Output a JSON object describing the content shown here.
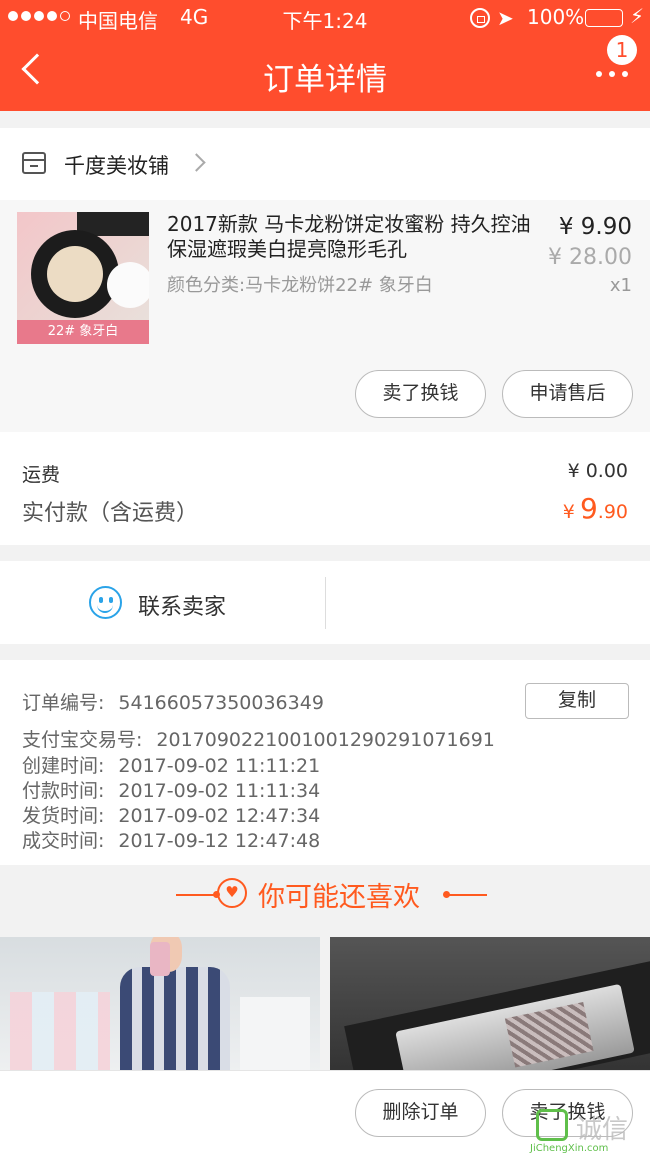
{
  "status_bar": {
    "carrier": "中国电信",
    "network": "4G",
    "time": "下午1:24",
    "battery": "100%"
  },
  "nav": {
    "title": "订单详情",
    "badge_count": "1"
  },
  "shop": {
    "name": "千度美妆铺"
  },
  "product": {
    "title": "2017新款 马卡龙粉饼定妆蜜粉 持久控油保湿遮瑕美白提亮隐形毛孔",
    "image_label": "22# 象牙白",
    "sku": "颜色分类:马卡龙粉饼22# 象牙白",
    "price": "¥ 9.90",
    "original_price": "¥ 28.00",
    "quantity": "x1",
    "actions": [
      "卖了换钱",
      "申请售后"
    ]
  },
  "fees": {
    "shipping_label": "运费",
    "shipping_value": "¥ 0.00",
    "paid_label": "实付款（含运费）",
    "paid_currency": "¥",
    "paid_int": "9",
    "paid_dec": ".90"
  },
  "contact": {
    "label": "联系卖家"
  },
  "order_info": {
    "copy_label": "复制",
    "rows": [
      {
        "label": "订单编号:",
        "value": "54166057350036349"
      },
      {
        "label": "支付宝交易号:",
        "value": "2017090221001001290291071691"
      },
      {
        "label": "创建时间:",
        "value": "2017-09-02 11:11:21"
      },
      {
        "label": "付款时间:",
        "value": "2017-09-02 11:11:34"
      },
      {
        "label": "发货时间:",
        "value": "2017-09-02 12:47:34"
      },
      {
        "label": "成交时间:",
        "value": "2017-09-12 12:47:48"
      }
    ]
  },
  "recommend": {
    "title": "你可能还喜欢"
  },
  "bottom": {
    "delete_label": "删除订单",
    "sell_label": "卖了换钱"
  },
  "watermark": {
    "text": "诚信",
    "sub": "JiChengXin.com"
  },
  "colors": {
    "header": "#ff4d2d",
    "accent": "#ff5a1f",
    "contact_icon": "#2aa3e8"
  }
}
